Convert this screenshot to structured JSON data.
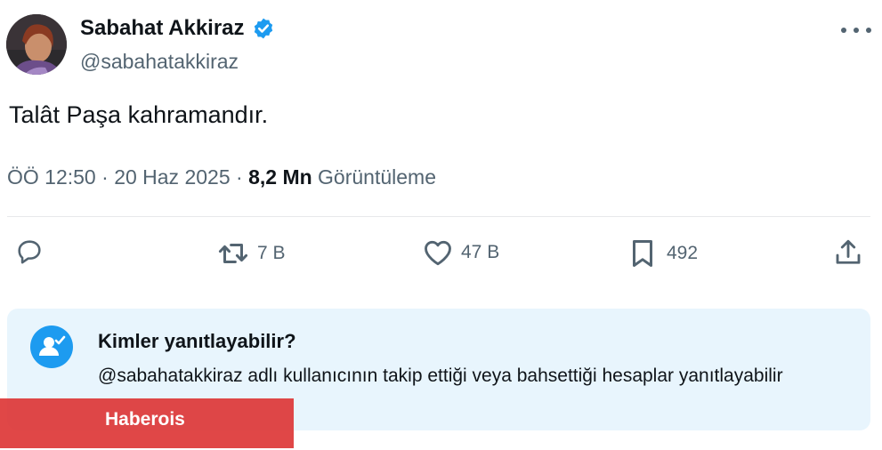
{
  "author": {
    "name": "Sabahat Akkiraz",
    "handle": "@sabahatakkiraz",
    "verified": true
  },
  "tweet": {
    "text": "Talât Paşa kahramandır.",
    "time": "ÖÖ 12:50",
    "date": "20 Haz 2025",
    "views_count": "8,2 Mn",
    "views_label": "Görüntüleme"
  },
  "actions": {
    "reply_count": "",
    "retweet_count": "7 B",
    "like_count": "47 B",
    "bookmark_count": "492"
  },
  "reply_restriction": {
    "title": "Kimler yanıtlayabilir?",
    "description": "@sabahatakkiraz adlı kullanıcının takip ettiği veya bahsettiği hesaplar yanıtlayabilir"
  },
  "watermark": {
    "text": "Haberois"
  },
  "colors": {
    "accent": "#1d9bf0",
    "secondary_text": "#536471",
    "reply_box_bg": "#e8f5fd",
    "watermark_bg": "#dd3333"
  }
}
